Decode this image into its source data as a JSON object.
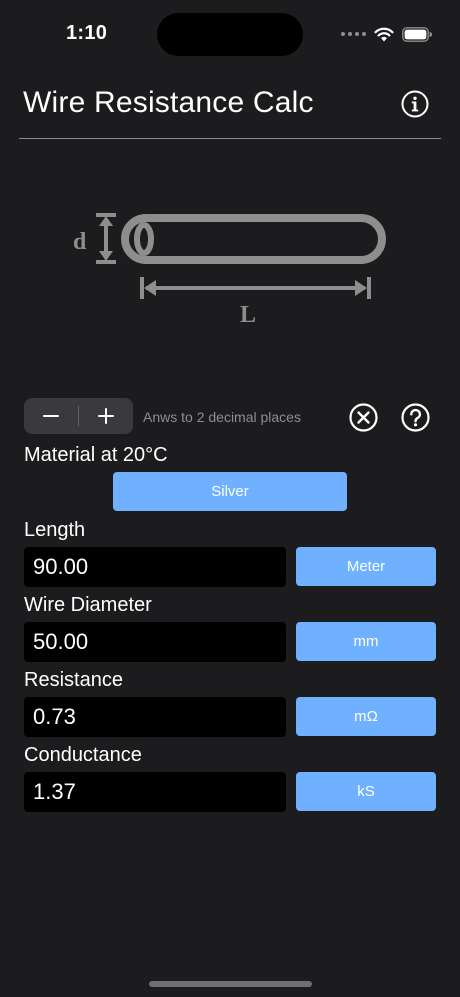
{
  "status_bar": {
    "time": "1:10",
    "icons": [
      "signal-dots-icon",
      "wifi-icon",
      "battery-icon"
    ]
  },
  "header": {
    "title": "Wire Resistance Calc",
    "info_icon": "info-circle-icon"
  },
  "diagram": {
    "diameter_label": "d",
    "length_label": "L"
  },
  "precision": {
    "minus_symbol": "−",
    "plus_symbol": "+",
    "label": "Anws to 2 decimal places",
    "clear_icon": "x-circle-icon",
    "help_icon": "question-circle-icon"
  },
  "material": {
    "label": "Material at 20°C",
    "value": "Silver"
  },
  "fields": {
    "length": {
      "label": "Length",
      "value": "90.00",
      "unit": "Meter"
    },
    "diameter": {
      "label": "Wire Diameter",
      "value": "50.00",
      "unit": "mm"
    },
    "resistance": {
      "label": "Resistance",
      "value": "0.73",
      "unit": "mΩ"
    },
    "conductance": {
      "label": "Conductance",
      "value": "1.37",
      "unit": "kS"
    }
  },
  "colors": {
    "background": "#1c1c1e",
    "accent_button": "#6fb1ff",
    "field_background": "#000000",
    "diagram_gray": "#8e8e8e"
  }
}
